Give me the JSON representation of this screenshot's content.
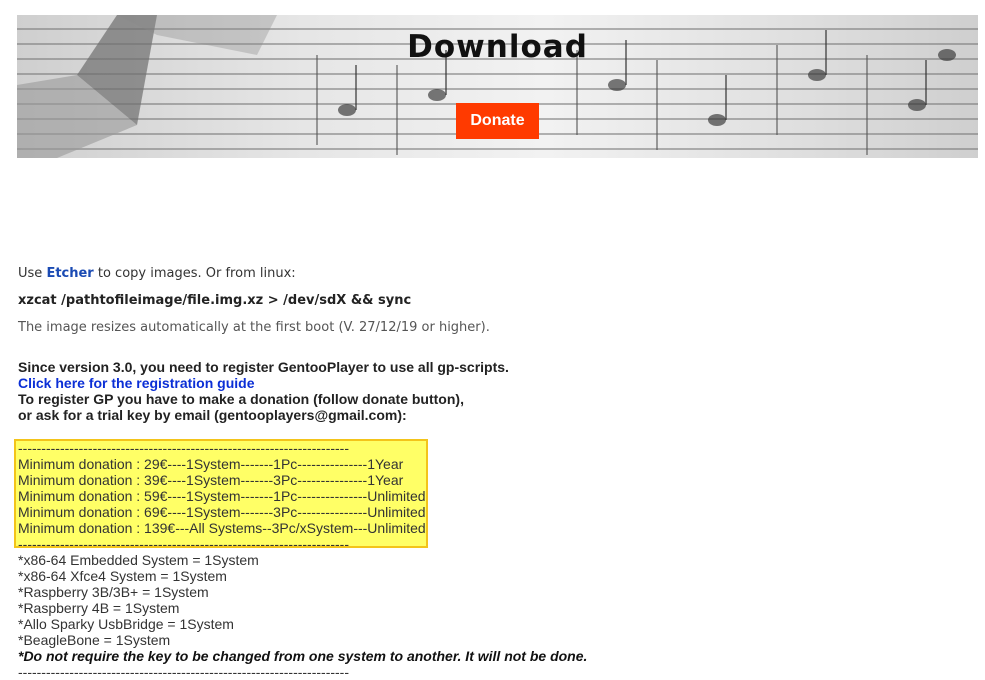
{
  "hero": {
    "title": "Download",
    "donate_label": "Donate"
  },
  "intro": {
    "use_prefix": "Use",
    "etcher_link": "Etcher",
    "use_suffix": "to copy images. Or from linux:",
    "command": "xzcat /pathtofileimage/file.img.xz > /dev/sdX && sync",
    "resize_note": "The image resizes automatically at the first boot (V. 27/12/19 or higher)."
  },
  "registration": {
    "line1": "Since version 3.0, you need to register GentooPlayer to use all gp-scripts.",
    "guide_link": "Click here for the registration guide",
    "line2": "To register GP you have to make a donation (follow donate button),",
    "line3": "or ask for a trial key by email (gentooplayers@gmail.com):"
  },
  "donations": {
    "separator": "-----------------------------------------------------------------------",
    "rows": [
      "Minimum donation : 29€----1System-------1Pc---------------1Year",
      "Minimum donation : 39€----1System-------3Pc---------------1Year",
      "Minimum donation : 59€----1System-------1Pc---------------Unlimited",
      "Minimum donation : 69€----1System-------3Pc---------------Unlimited",
      "Minimum donation : 139€---All Systems--3Pc/xSystem---Unlimited"
    ],
    "highlight_color": "#ffff66"
  },
  "systems": {
    "items": [
      "*x86-64 Embedded System = 1System",
      "*x86-64 Xfce4 System = 1System",
      "*Raspberry 3B/3B+ = 1System",
      "*Raspberry 4B = 1System",
      "*Allo Sparky UsbBridge = 1System",
      "*BeagleBone = 1System"
    ],
    "note": "*Do not require the key to be changed from one system to another. It will not be done.",
    "separator": "-----------------------------------------------------------------------"
  },
  "colors": {
    "donate": "#ff3a00",
    "link": "#1a4ab3"
  }
}
